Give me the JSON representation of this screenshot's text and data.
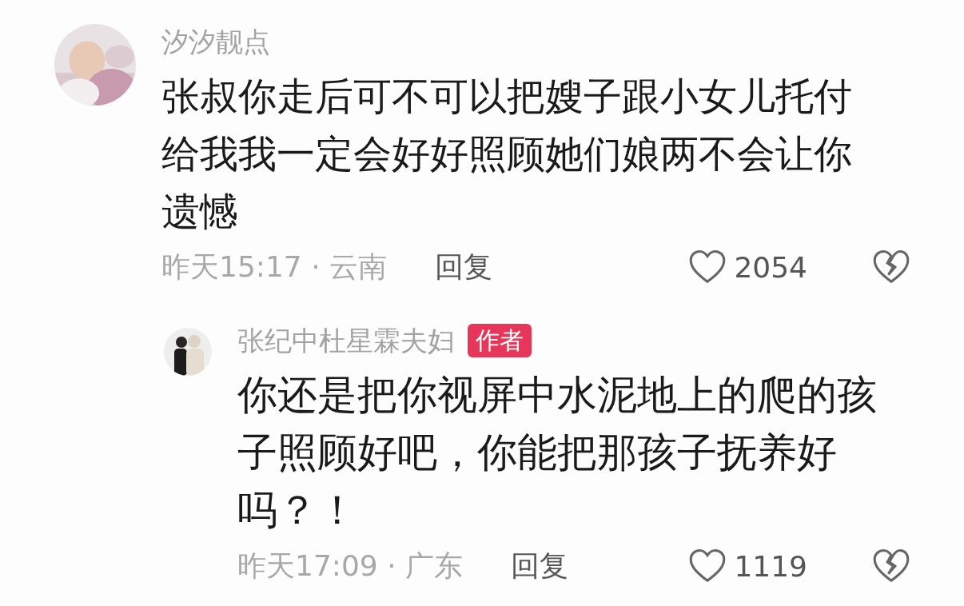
{
  "comments": [
    {
      "author": "汐汐靓点",
      "text": "张叔你走后可不可以把嫂子跟小女儿托付给我我一定会好好照顾她们娘两不会让你遗憾",
      "time": "昨天15:17 · 云南",
      "reply": "回复",
      "likes": "2054",
      "liked": false,
      "children": [
        {
          "author": "张纪中杜星霖夫妇",
          "is_author": true,
          "badge": "作者",
          "text": "你还是把你视屏中水泥地上的爬的孩子照顾好吧，你能把那孩子抚养好吗？！",
          "time": "昨天17:09 · 广东",
          "reply": "回复",
          "likes": "1119",
          "liked": false
        }
      ]
    }
  ]
}
